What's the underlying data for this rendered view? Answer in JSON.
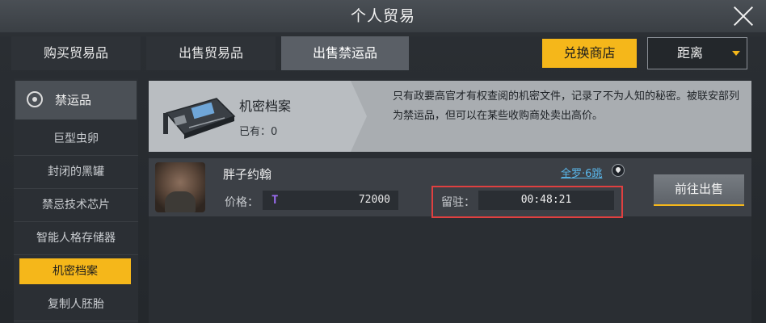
{
  "window": {
    "title": "个人贸易"
  },
  "tabs": [
    {
      "label": "购买贸易品",
      "active": false
    },
    {
      "label": "出售贸易品",
      "active": false
    },
    {
      "label": "出售禁运品",
      "active": true
    }
  ],
  "toolbar": {
    "shop_label": "兑换商店",
    "sort_label": "距离"
  },
  "sidebar": {
    "header_label": "禁运品",
    "items": [
      {
        "label": "巨型虫卵"
      },
      {
        "label": "封闭的黑罐"
      },
      {
        "label": "禁忌技术芯片"
      },
      {
        "label": "智能人格存储器"
      },
      {
        "label": "机密档案",
        "selected": true
      },
      {
        "label": "复制人胚胎"
      }
    ]
  },
  "item_info": {
    "name": "机密档案",
    "owned": "已有：0",
    "description": "只有政要高官才有权查阅的机密文件，记录了不为人知的秘密。被联安部列为禁运品，但可以在某些收购商处卖出高价。"
  },
  "seller": {
    "name": "胖子约翰",
    "location": "全罗·6跳",
    "price_label": "价格：",
    "price_value": "72000",
    "currency_icon": "T",
    "stay_label": "留驻：",
    "stay_time": "00:48:21",
    "sell_button": "前往出售"
  },
  "colors": {
    "accent": "#f5b71a",
    "link": "#5ab8ec",
    "highlight": "#e04040",
    "currency": "#9b6cf2"
  }
}
